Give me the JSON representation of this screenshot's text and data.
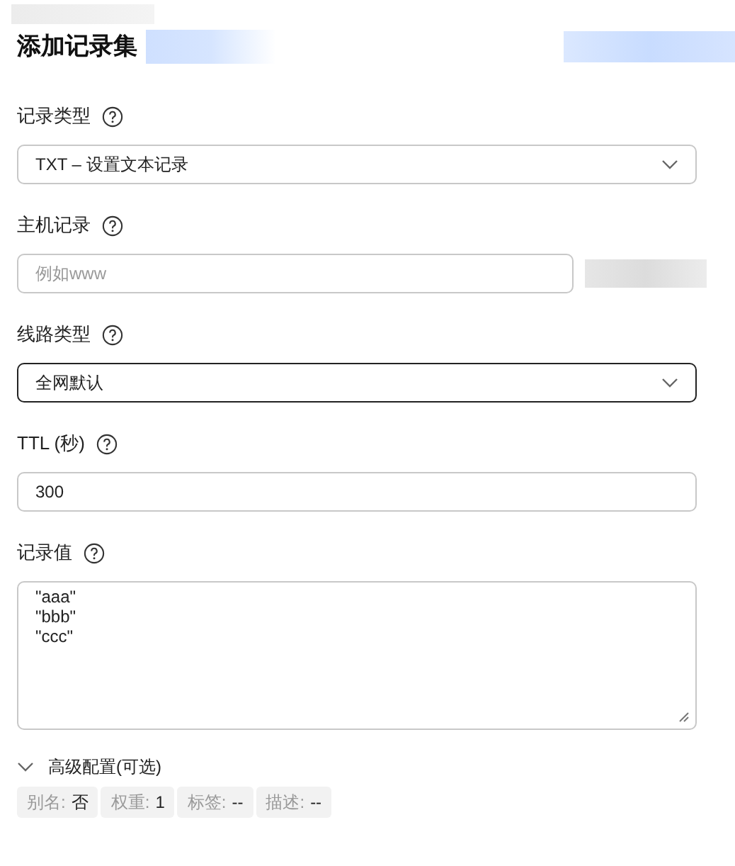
{
  "title": "添加记录集",
  "fields": [
    {
      "kind": "select",
      "label": "记录类型",
      "value": "TXT – 设置文本记录",
      "focused": false
    },
    {
      "kind": "input",
      "label": "主机记录",
      "placeholder": "例如www",
      "suffix_redacted": true
    },
    {
      "kind": "select",
      "label": "线路类型",
      "value": "全网默认",
      "focused": true
    },
    {
      "kind": "input",
      "label": "TTL (秒)",
      "value": "300"
    },
    {
      "kind": "textarea",
      "label": "记录值",
      "value": "\"aaa\"\n\"bbb\"\n\"ccc\""
    }
  ],
  "advanced": {
    "label": "高级配置(可选)",
    "expanded": false
  },
  "tags": [
    {
      "key": "别名:",
      "value": "否"
    },
    {
      "key": "权重:",
      "value": "1"
    },
    {
      "key": "标签:",
      "value": "--"
    },
    {
      "key": "描述:",
      "value": "--"
    }
  ]
}
